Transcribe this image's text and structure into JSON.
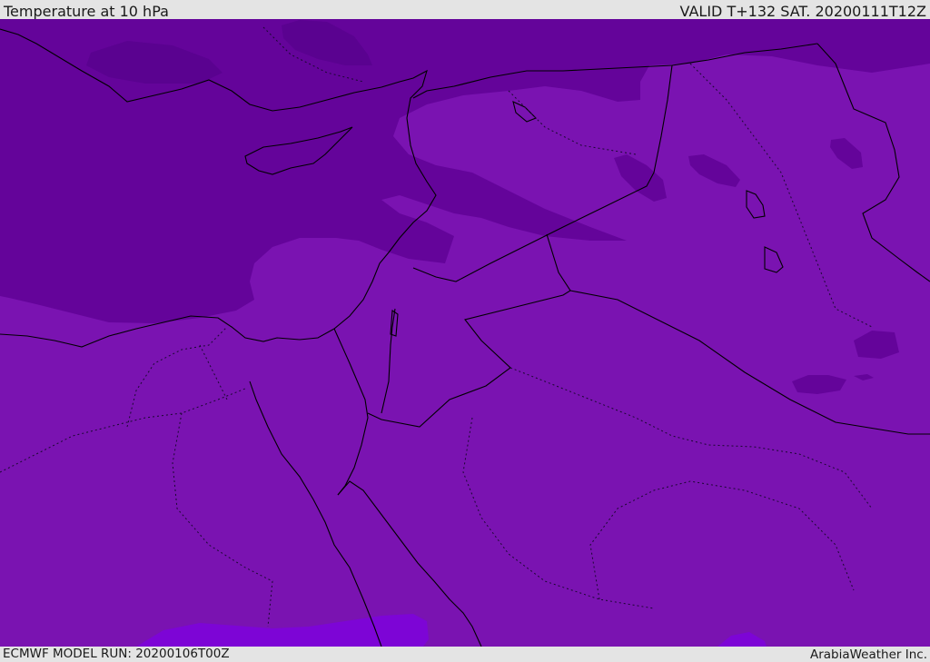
{
  "header": {
    "title": "Temperature at 10 hPa",
    "valid_time": "VALID T+132 SAT. 20200111T12Z"
  },
  "footer": {
    "model_run": "ECMWF MODEL RUN: 20200106T00Z",
    "credit": "ArabiaWeather Inc."
  },
  "colors": {
    "base_field": "#7a13b1",
    "cold_field": "#64049a",
    "colder_field": "#5a0290",
    "warm_field": "#7d05d6",
    "boundary": "#000000"
  }
}
